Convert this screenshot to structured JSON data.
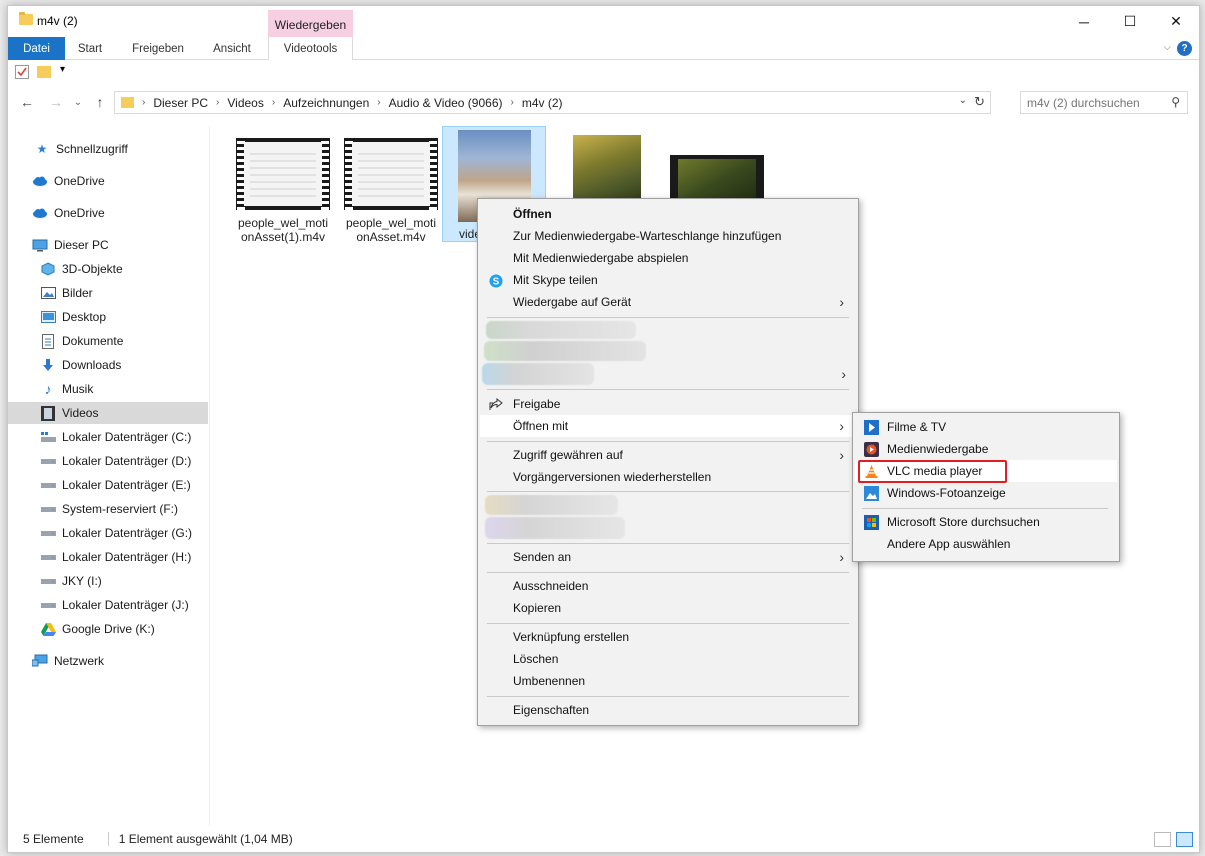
{
  "window": {
    "title": "m4v (2)",
    "context_tab_header": "Wiedergeben",
    "minimize": "─",
    "maximize": "☐",
    "close": "✕"
  },
  "ribbon": {
    "tabs": [
      "Datei",
      "Start",
      "Freigeben",
      "Ansicht",
      "Videotools"
    ],
    "help": "?"
  },
  "address": {
    "breadcrumbs": [
      "Dieser PC",
      "Videos",
      "Aufzeichnungen",
      "Audio & Video (9066)",
      "m4v (2)"
    ],
    "search_placeholder": "m4v (2) durchsuchen"
  },
  "nav": {
    "items": [
      {
        "label": "Schnellzugriff",
        "icon": "star-icon"
      },
      {
        "label": "OneDrive",
        "icon": "cloud-icon"
      },
      {
        "label": "OneDrive",
        "icon": "cloud-icon"
      },
      {
        "label": "Dieser PC",
        "icon": "computer-icon"
      },
      {
        "label": "3D-Objekte",
        "icon": "cube-icon"
      },
      {
        "label": "Bilder",
        "icon": "pictures-icon"
      },
      {
        "label": "Desktop",
        "icon": "desktop-icon"
      },
      {
        "label": "Dokumente",
        "icon": "document-icon"
      },
      {
        "label": "Downloads",
        "icon": "download-icon"
      },
      {
        "label": "Musik",
        "icon": "music-icon"
      },
      {
        "label": "Videos",
        "icon": "video-icon"
      },
      {
        "label": "Lokaler Datenträger (C:)",
        "icon": "drive-icon"
      },
      {
        "label": "Lokaler Datenträger (D:)",
        "icon": "drive-icon"
      },
      {
        "label": "Lokaler Datenträger (E:)",
        "icon": "drive-icon"
      },
      {
        "label": "System-reserviert (F:)",
        "icon": "drive-icon"
      },
      {
        "label": "Lokaler Datenträger (G:)",
        "icon": "drive-icon"
      },
      {
        "label": "Lokaler Datenträger (H:)",
        "icon": "drive-icon"
      },
      {
        "label": "JKY (I:)",
        "icon": "drive-icon"
      },
      {
        "label": "Lokaler Datenträger (J:)",
        "icon": "drive-icon"
      },
      {
        "label": "Google Drive (K:)",
        "icon": "google-drive-icon"
      },
      {
        "label": "Netzwerk",
        "icon": "network-icon"
      }
    ],
    "selected": "Videos"
  },
  "files": [
    {
      "name_line1": "people_wel_moti",
      "name_line2": "onAsset(1).m4v"
    },
    {
      "name_line1": "people_wel_moti",
      "name_line2": "onAsset.m4v"
    },
    {
      "name_line1": "vide",
      "name_line2": ""
    },
    {
      "name_line1": "",
      "name_line2": ""
    },
    {
      "name_line1": "",
      "name_line2": ""
    }
  ],
  "context_menu": {
    "items": {
      "open": "Öffnen",
      "add_queue": "Zur Medienwiedergabe-Warteschlange hinzufügen",
      "play_media": "Mit Medienwiedergabe abspielen",
      "skype": "Mit Skype teilen",
      "cast": "Wiedergabe auf Gerät",
      "share": "Freigabe",
      "open_with": "Öffnen mit",
      "give_access": "Zugriff gewähren auf",
      "restore": "Vorgängerversionen wiederherstellen",
      "send_to": "Senden an",
      "cut": "Ausschneiden",
      "copy": "Kopieren",
      "shortcut": "Verknüpfung erstellen",
      "delete": "Löschen",
      "rename": "Umbenennen",
      "properties": "Eigenschaften"
    }
  },
  "submenu": {
    "items": {
      "films_tv": "Filme & TV",
      "media_player": "Medienwiedergabe",
      "vlc": "VLC media player",
      "photo_viewer": "Windows-Fotoanzeige",
      "store": "Microsoft Store durchsuchen",
      "other_app": "Andere App auswählen"
    }
  },
  "status": {
    "count": "5 Elemente",
    "selection": "1 Element ausgewählt (1,04 MB)"
  },
  "colors": {
    "accent": "#1a73c7",
    "context_tab": "#f7cfe2",
    "selection": "#cce8ff",
    "highlight_box": "#e02020"
  }
}
